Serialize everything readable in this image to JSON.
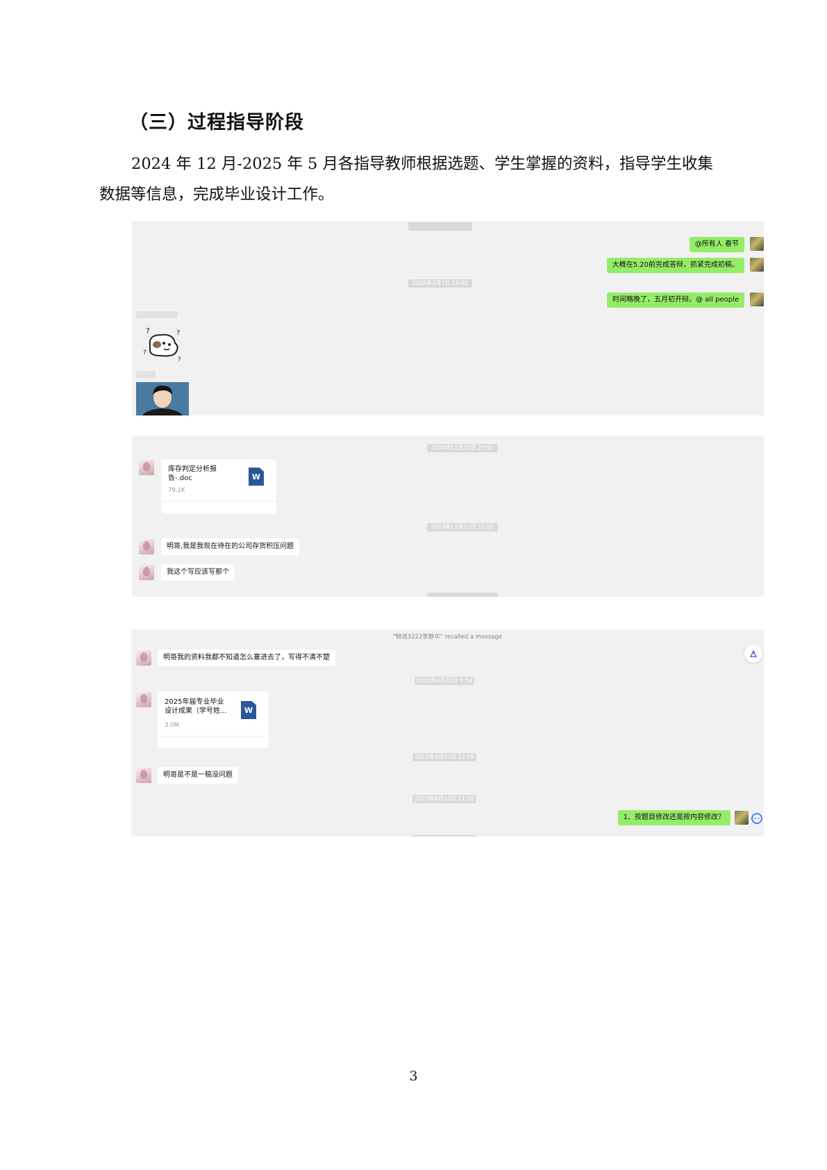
{
  "heading": "（三）过程指导阶段",
  "paragraph": {
    "line1": "2024 年 12 月-2025 年 5 月各指导教师根据选题、学生掌握的资料，指导学生收集",
    "line2": "数据等信息，完成毕业设计工作。"
  },
  "screenshot1": {
    "timestamp1": "",
    "timestamp2": "2025年4月7日 16:45",
    "messages_me": [
      "@所有人 春节",
      "大概在5.20前完成答辩，抓紧完成初稿。",
      "时间略晚了，五月初开辩。@ all people"
    ],
    "sender1": "",
    "sender2": ""
  },
  "screenshot2": {
    "timestamp1": "2024年11月11日 21:51",
    "timestamp2": "2024年11月11日 21:52",
    "file": {
      "name_line1": "库存判定分析报",
      "name_line2": "告-.doc",
      "size": "79.1K",
      "source": "",
      "icon": "W"
    },
    "messages_other": [
      "明哥,我是我现在待在的公司存货积压问题",
      "我这个写应该写那个"
    ]
  },
  "screenshot3": {
    "recall": "\"物流3222李静华\" recalled a message",
    "message1": "明哥我的资料我都不知道怎么塞进去了，写得不清不楚",
    "timestamp1": "2025年4月22日 0:54",
    "file": {
      "name_line1": "2025年届专业毕业",
      "name_line2": "设计成果（学号姓...",
      "size": "3.0M",
      "source": "",
      "icon": "W"
    },
    "timestamp2": "2025年4月22日 12:58",
    "message2": "明哥是不是一稿没问题",
    "timestamp3": "2025年4月22日 11:15",
    "message_me": "1、按题目修改还是按内容修改？"
  },
  "page_number": "3"
}
